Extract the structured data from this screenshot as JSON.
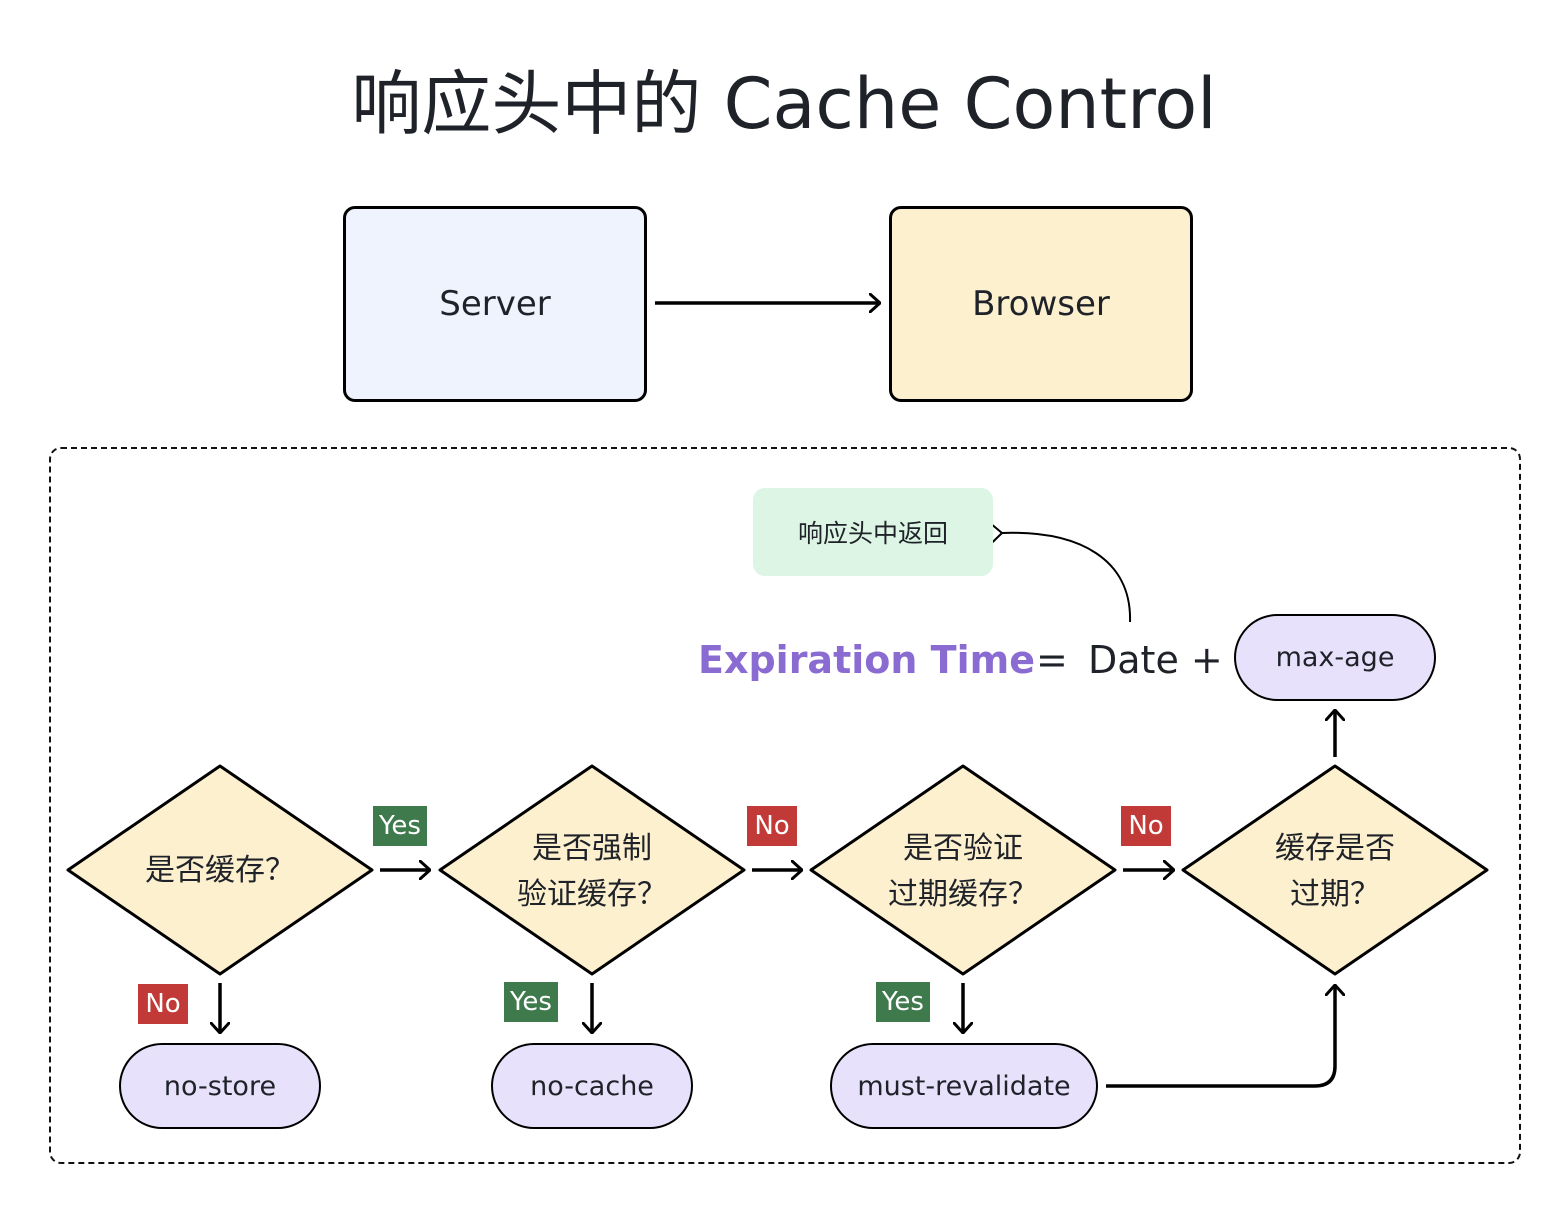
{
  "title": "响应头中的 Cache Control",
  "nodes": {
    "server": "Server",
    "browser": "Browser",
    "note": "响应头中返回"
  },
  "formula": {
    "lhs": "Expiration Time",
    "equals": "=",
    "date_plus": "Date +",
    "lhs_color": "#8a6bd1"
  },
  "decisions": [
    {
      "line1": "是否缓存？",
      "line2": ""
    },
    {
      "line1": "是否强制",
      "line2": "验证缓存？"
    },
    {
      "line1": "是否验证",
      "line2": "过期缓存？"
    },
    {
      "line1": "缓存是否",
      "line2": "过期？"
    }
  ],
  "directives": {
    "max_age": "max-age",
    "no_store": "no-store",
    "no_cache": "no-cache",
    "must_revalidate": "must-revalidate"
  },
  "edge_labels": {
    "d1_right": "Yes",
    "d1_down": "No",
    "d2_right": "No",
    "d2_down": "Yes",
    "d3_right": "No",
    "d3_down": "Yes"
  },
  "colors": {
    "yes": "#3f7a4d",
    "no": "#c23a37",
    "decision_fill": "#fdf0ce",
    "directive_fill": "#e7e1fb",
    "server_fill": "#eef3fd",
    "browser_fill": "#fdf0ce",
    "note_fill": "#dcf5e4"
  }
}
